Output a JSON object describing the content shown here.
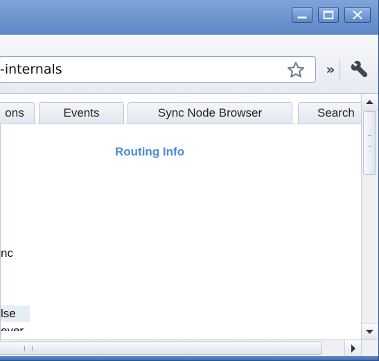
{
  "window": {
    "minimize_label": "",
    "maximize_label": "",
    "close_label": ""
  },
  "toolbar": {
    "address": "-internals",
    "chevron_label": "»"
  },
  "tabs": [
    {
      "label": "ons"
    },
    {
      "label": "Events"
    },
    {
      "label": "Sync Node Browser"
    },
    {
      "label": "Search"
    }
  ],
  "panel": {
    "heading": "Routing Info",
    "row_nc": "nc",
    "row_false": "lse",
    "row_cut": "ever"
  },
  "colors": {
    "heading": "#4a8bdc",
    "titlebar": "#5d88c7",
    "selected_row": "#e7edf7"
  },
  "icons": {
    "star": "star-icon",
    "chevron": "chevron-double-right-icon",
    "wrench": "wrench-icon"
  }
}
